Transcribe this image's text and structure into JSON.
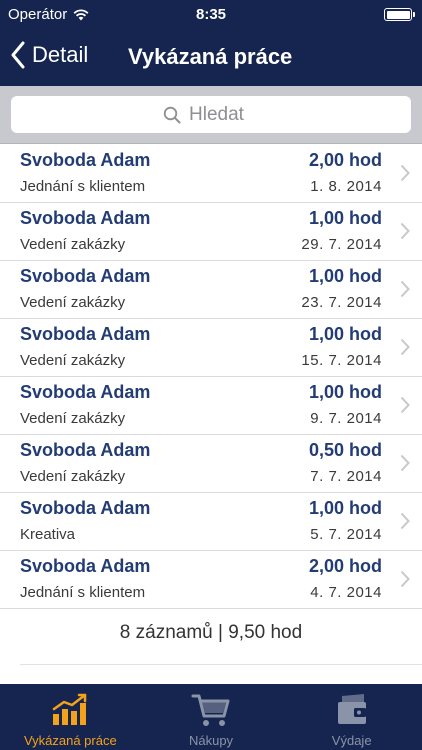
{
  "statusbar": {
    "carrier": "Operátor",
    "time": "8:35"
  },
  "navbar": {
    "back_label": "Detail",
    "title": "Vykázaná práce"
  },
  "search": {
    "placeholder": "Hledat"
  },
  "entries": [
    {
      "name": "Svoboda Adam",
      "hours": "2,00 hod",
      "description": "Jednání s klientem",
      "date": "1. 8. 2014"
    },
    {
      "name": "Svoboda Adam",
      "hours": "1,00 hod",
      "description": "Vedení zakázky",
      "date": "29. 7. 2014"
    },
    {
      "name": "Svoboda Adam",
      "hours": "1,00 hod",
      "description": "Vedení zakázky",
      "date": "23. 7. 2014"
    },
    {
      "name": "Svoboda Adam",
      "hours": "1,00 hod",
      "description": "Vedení zakázky",
      "date": "15. 7. 2014"
    },
    {
      "name": "Svoboda Adam",
      "hours": "1,00 hod",
      "description": "Vedení zakázky",
      "date": "9. 7. 2014"
    },
    {
      "name": "Svoboda Adam",
      "hours": "0,50 hod",
      "description": "Vedení zakázky",
      "date": "7. 7. 2014"
    },
    {
      "name": "Svoboda Adam",
      "hours": "1,00 hod",
      "description": "Kreativa",
      "date": "5. 7. 2014"
    },
    {
      "name": "Svoboda Adam",
      "hours": "2,00 hod",
      "description": "Jednání s klientem",
      "date": "4. 7. 2014"
    }
  ],
  "summary": "8 záznamů | 9,50 hod",
  "tabs": [
    {
      "label": "Vykázaná práce",
      "icon": "chart-icon",
      "active": true
    },
    {
      "label": "Nákupy",
      "icon": "cart-icon",
      "active": false
    },
    {
      "label": "Výdaje",
      "icon": "wallet-icon",
      "active": false
    }
  ],
  "colors": {
    "nav_bg": "#15254f",
    "accent": "#f4a21c",
    "name_text": "#233d74"
  }
}
